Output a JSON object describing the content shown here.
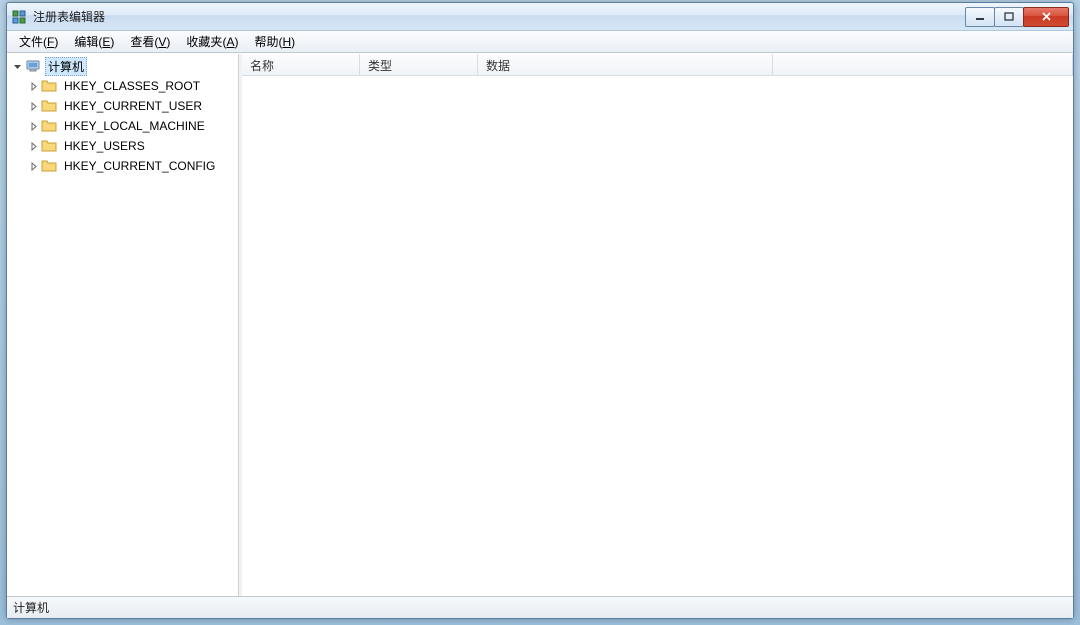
{
  "window": {
    "title": "注册表编辑器"
  },
  "menu": {
    "file": {
      "label": "文件",
      "accel": "F"
    },
    "edit": {
      "label": "编辑",
      "accel": "E"
    },
    "view": {
      "label": "查看",
      "accel": "V"
    },
    "favorites": {
      "label": "收藏夹",
      "accel": "A"
    },
    "help": {
      "label": "帮助",
      "accel": "H"
    }
  },
  "tree": {
    "root": {
      "label": "计算机",
      "expanded": true,
      "selected": true
    },
    "children": [
      {
        "label": "HKEY_CLASSES_ROOT"
      },
      {
        "label": "HKEY_CURRENT_USER"
      },
      {
        "label": "HKEY_LOCAL_MACHINE"
      },
      {
        "label": "HKEY_USERS"
      },
      {
        "label": "HKEY_CURRENT_CONFIG"
      }
    ]
  },
  "columns": {
    "name": "名称",
    "type": "类型",
    "data": "数据"
  },
  "statusbar": {
    "path": "计算机"
  }
}
